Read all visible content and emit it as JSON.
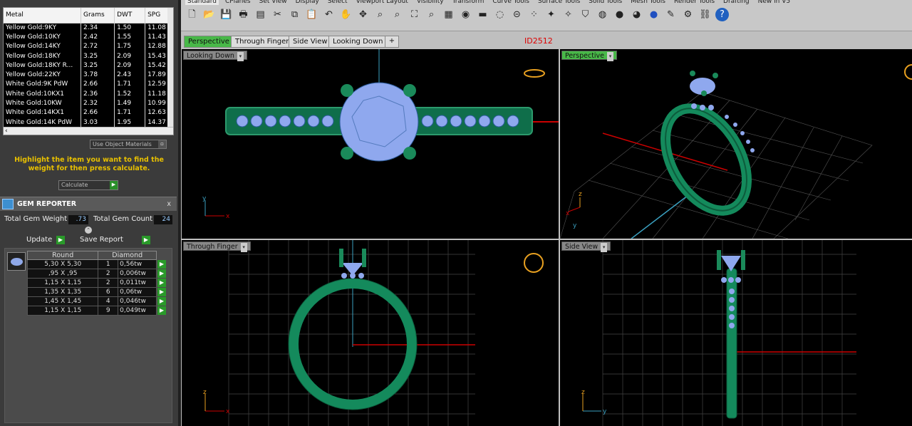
{
  "metals": {
    "headers": [
      "Metal",
      "Grams",
      "DWT",
      "SPG"
    ],
    "rows": [
      [
        "Yellow Gold:9KY",
        "2.34",
        "1.50",
        "11.08"
      ],
      [
        "Yellow Gold:10KY",
        "2.42",
        "1.55",
        "11.43"
      ],
      [
        "Yellow Gold:14KY",
        "2.72",
        "1.75",
        "12.88"
      ],
      [
        "Yellow Gold:18KY",
        "3.25",
        "2.09",
        "15.43"
      ],
      [
        "Yellow Gold:18KY R...",
        "3.25",
        "2.09",
        "15.42"
      ],
      [
        "Yellow Gold:22KY",
        "3.78",
        "2.43",
        "17.89"
      ],
      [
        "White Gold:9K PdW",
        "2.66",
        "1.71",
        "12.59"
      ],
      [
        "White Gold:10KX1",
        "2.36",
        "1.52",
        "11.18"
      ],
      [
        "White Gold:10KW",
        "2.32",
        "1.49",
        "10.99"
      ],
      [
        "White Gold:14KX1",
        "2.66",
        "1.71",
        "12.63"
      ],
      [
        "White Gold:14K PdW",
        "3.03",
        "1.95",
        "14.37"
      ]
    ]
  },
  "use_object_materials": "Use Object Materials",
  "hint": "Highlight the item you want to find the weight for then press calculate.",
  "calculate_label": "Calculate",
  "gem_reporter": {
    "title": "GEM REPORTER",
    "close": "x",
    "total_weight_label": "Total Gem Weight",
    "total_weight_value": ".73",
    "total_count_label": "Total Gem Count",
    "total_count_value": "24",
    "update_label": "Update",
    "save_report_label": "Save Report",
    "shape": "Round",
    "material": "Diamond",
    "rows": [
      [
        "5,30 X 5,30",
        "1",
        "0,56tw"
      ],
      [
        ",95 X ,95",
        "2",
        "0,006tw"
      ],
      [
        "1,15 X 1,15",
        "2",
        "0,011tw"
      ],
      [
        "1,35 X 1,35",
        "6",
        "0,06tw"
      ],
      [
        "1,45 X 1,45",
        "4",
        "0,046tw"
      ],
      [
        "1,15 X 1,15",
        "9",
        "0,049tw"
      ]
    ]
  },
  "toolbar": {
    "menus": [
      "Standard",
      "CPlanes",
      "Set View",
      "Display",
      "Select",
      "Viewport Layout",
      "Visibility",
      "Transform",
      "Curve Tools",
      "Surface Tools",
      "Solid Tools",
      "Mesh Tools",
      "Render Tools",
      "Drafting",
      "New in V5"
    ],
    "icons": [
      "new-file-icon",
      "open-file-icon",
      "save-icon",
      "print-icon",
      "properties-icon",
      "cut-icon",
      "copy-icon",
      "paste-icon",
      "undo-icon",
      "pan-icon",
      "rotate-view-icon",
      "zoom-icon",
      "zoom-window-icon",
      "zoom-extents-icon",
      "zoom-selected-icon",
      "grid-icon",
      "camera-icon",
      "car-icon",
      "hide-icon",
      "lock-icon",
      "snap-icon",
      "light-icon",
      "light2-icon",
      "shield-icon",
      "color-wheel-icon",
      "sphere-grey-icon",
      "sphere-shaded-icon",
      "sphere-blue-icon",
      "pencil-icon",
      "settings-icon",
      "layers-icon",
      "help-icon"
    ]
  },
  "viewport_tabs": [
    "Perspective",
    "Through Finger",
    "Side View",
    "Looking Down"
  ],
  "add_tab": "+",
  "id_label": "ID2512",
  "viewports": {
    "looking_down": "Looking Down",
    "perspective": "Perspective",
    "through_finger": "Through Finger",
    "side_view": "Side View"
  },
  "axes": {
    "x": "x",
    "y": "y",
    "z": "z"
  }
}
